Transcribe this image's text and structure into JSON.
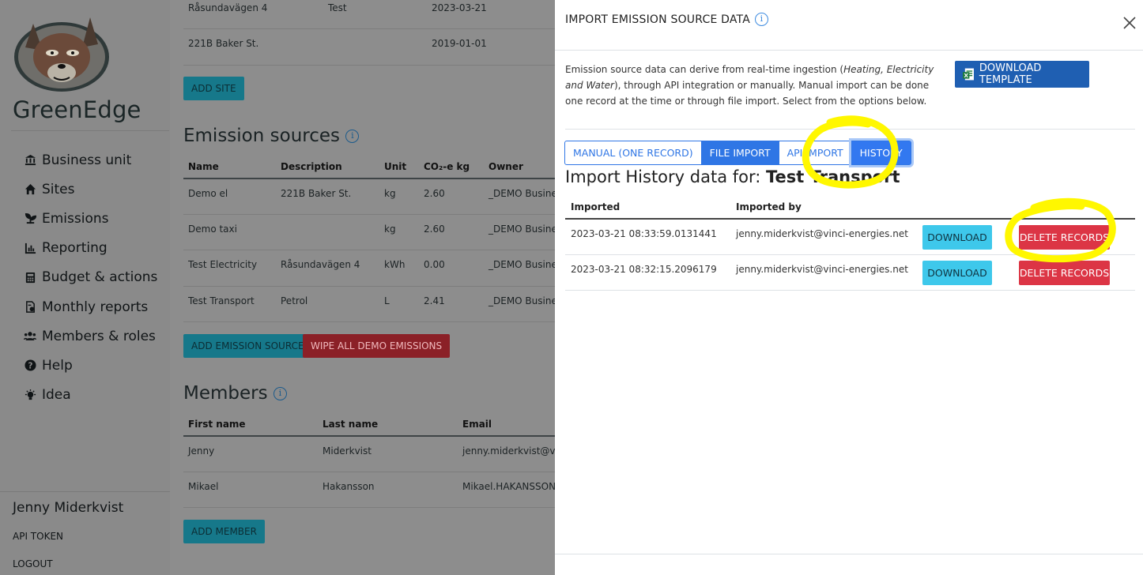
{
  "brand": "GreenEdge",
  "nav": [
    {
      "label": "Business unit",
      "icon": "bank-icon"
    },
    {
      "label": "Sites",
      "icon": "home-icon"
    },
    {
      "label": "Emissions",
      "icon": "seedling-icon"
    },
    {
      "label": "Reporting",
      "icon": "bar-chart-icon"
    },
    {
      "label": "Budget & actions",
      "icon": "calculator-icon"
    },
    {
      "label": "Monthly reports",
      "icon": "file-report-icon"
    },
    {
      "label": "Members & roles",
      "icon": "users-icon"
    },
    {
      "label": "Help",
      "icon": "question-circle-icon"
    },
    {
      "label": "Idea",
      "icon": "lightbulb-icon"
    }
  ],
  "user": {
    "name": "Jenny Miderkvist",
    "api_token": "API TOKEN",
    "logout": "LOGOUT"
  },
  "sites": {
    "rows": [
      {
        "c1": "Råsundavägen 4",
        "c2": "Test",
        "c3": "2023-03-21"
      },
      {
        "c1": "221B Baker St.",
        "c2": "",
        "c3": "2019-01-01"
      }
    ],
    "add_button": "ADD SITE"
  },
  "emission_sources": {
    "title": "Emission sources",
    "headers": {
      "name": "Name",
      "description": "Description",
      "unit": "Unit",
      "co2": "CO₂-e kg",
      "owner": "Owner"
    },
    "rows": [
      {
        "name": "Demo el",
        "description": "221B Baker St.",
        "unit": "kg",
        "co2": "2.60",
        "owner": "_DEMO Busines"
      },
      {
        "name": "Demo taxi",
        "description": "",
        "unit": "kg",
        "co2": "2.60",
        "owner": "_DEMO Busines"
      },
      {
        "name": "Test Electricity",
        "description": "Råsundavägen 4",
        "unit": "kWh",
        "co2": "0.00",
        "owner": "_DEMO Busines"
      },
      {
        "name": "Test Transport",
        "description": "Petrol",
        "unit": "L",
        "co2": "2.41",
        "owner": "_DEMO Busines"
      }
    ],
    "add_button": "ADD EMISSION SOURCE",
    "wipe_button": "WIPE ALL DEMO EMISSIONS"
  },
  "members": {
    "title": "Members",
    "headers": {
      "first": "First name",
      "last": "Last name",
      "email": "Email"
    },
    "rows": [
      {
        "first": "Jenny",
        "last": "Miderkvist",
        "email": "jenny.miderkvist@vinci"
      },
      {
        "first": "Mikael",
        "last": "Hakansson",
        "email": "Mikael.HAKANSSON@"
      }
    ],
    "add_button": "ADD MEMBER"
  },
  "modal": {
    "title": "IMPORT EMISSION SOURCE DATA",
    "description_before": "Emission source data can derive from real-time ingestion (",
    "description_italic": "Heating, Electricity and Water",
    "description_after": "), through API integration or manually. Manual import can be done one record at the time or through file import. Select from the options below.",
    "download_template": "DOWNLOAD TEMPLATE",
    "tabs": [
      "MANUAL (ONE RECORD)",
      "FILE IMPORT",
      "API IMPORT",
      "HISTORY"
    ],
    "history_prefix": "Import History data for: ",
    "history_source": "Test Transport",
    "table_headers": {
      "imported": "Imported",
      "imported_by": "Imported by"
    },
    "rows": [
      {
        "imported": "2023-03-21 08:33:59.0131441",
        "by": "jenny.miderkvist@vinci-energies.net",
        "download": "DOWNLOAD",
        "delete": "DELETE RECORDS"
      },
      {
        "imported": "2023-03-21 08:32:15.2096179",
        "by": "jenny.miderkvist@vinci-energies.net",
        "download": "DOWNLOAD",
        "delete": "DELETE RECORDS"
      }
    ]
  },
  "colors": {
    "highlight": "#fff700",
    "primary": "#2f76e5",
    "danger": "#dc3545",
    "info": "#3ec8eb"
  }
}
